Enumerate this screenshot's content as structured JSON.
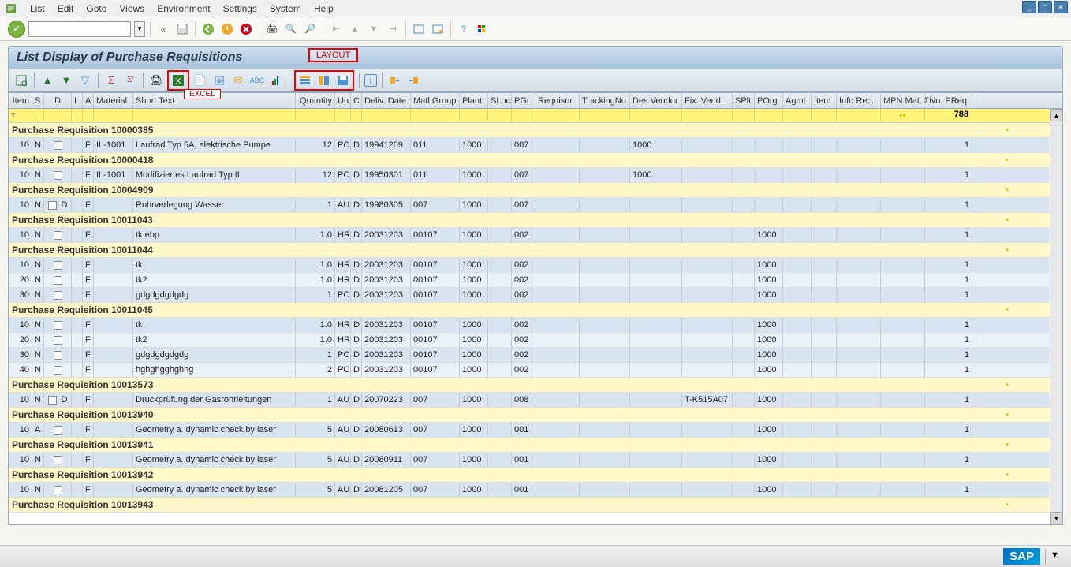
{
  "menu": {
    "items": [
      "List",
      "Edit",
      "Goto",
      "Views",
      "Environment",
      "Settings",
      "System",
      "Help"
    ]
  },
  "title": "List Display of Purchase Requisitions",
  "annotations": {
    "layout": "LAYOUT",
    "excel": "EXCEL"
  },
  "columns": [
    "Item",
    "S",
    "D",
    "I",
    "A",
    "Material",
    "Short Text",
    "Quantity",
    "Un",
    "C",
    "Deliv. Date",
    "Matl Group",
    "Plant",
    "SLoc",
    "PGr",
    "Requisnr.",
    "TrackingNo",
    "Des.Vendor",
    "Fix. Vend.",
    "SPlt",
    "POrg",
    "Agmt",
    "Item",
    "Info Rec.",
    "MPN Mat.",
    "ΣNo. PReq."
  ],
  "total": "788",
  "groups": [
    {
      "label": "Purchase Requisition 10000385",
      "count": "1",
      "rows": [
        {
          "item": "10",
          "s": "N",
          "d": "",
          "i": "",
          "a": "F",
          "mat": "IL-1001",
          "txt": "Laufrad Typ 5A, elektrische Pumpe",
          "qty": "12",
          "un": "PC",
          "c": "D",
          "deliv": "19941209",
          "mg": "011",
          "plant": "1000",
          "sloc": "",
          "pgr": "007",
          "req": "",
          "trk": "",
          "desv": "1000",
          "fix": "",
          "splt": "",
          "porg": "",
          "agmt": "",
          "it2": "",
          "info": "",
          "mpn": "",
          "np": "1"
        }
      ]
    },
    {
      "label": "Purchase Requisition 10000418",
      "count": "1",
      "rows": [
        {
          "item": "10",
          "s": "N",
          "d": "",
          "i": "",
          "a": "F",
          "mat": "IL-1001",
          "txt": "Modifiziertes Laufrad Typ II",
          "qty": "12",
          "un": "PC",
          "c": "D",
          "deliv": "19950301",
          "mg": "011",
          "plant": "1000",
          "sloc": "",
          "pgr": "007",
          "req": "",
          "trk": "",
          "desv": "1000",
          "fix": "",
          "splt": "",
          "porg": "",
          "agmt": "",
          "it2": "",
          "info": "",
          "mpn": "",
          "np": "1"
        }
      ]
    },
    {
      "label": "Purchase Requisition 10004909",
      "count": "1",
      "rows": [
        {
          "item": "10",
          "s": "N",
          "d": "D",
          "i": "",
          "a": "F",
          "mat": "",
          "txt": "Rohrverlegung Wasser",
          "qty": "1",
          "un": "AU",
          "c": "D",
          "deliv": "19980305",
          "mg": "007",
          "plant": "1000",
          "sloc": "",
          "pgr": "007",
          "req": "",
          "trk": "",
          "desv": "",
          "fix": "",
          "splt": "",
          "porg": "",
          "agmt": "",
          "it2": "",
          "info": "",
          "mpn": "",
          "np": "1"
        }
      ]
    },
    {
      "label": "Purchase Requisition 10011043",
      "count": "1",
      "rows": [
        {
          "item": "10",
          "s": "N",
          "d": "",
          "i": "",
          "a": "F",
          "mat": "",
          "txt": "tk ebp",
          "qty": "1.0",
          "un": "HR",
          "c": "D",
          "deliv": "20031203",
          "mg": "00107",
          "plant": "1000",
          "sloc": "",
          "pgr": "002",
          "req": "",
          "trk": "",
          "desv": "",
          "fix": "",
          "splt": "",
          "porg": "1000",
          "agmt": "",
          "it2": "",
          "info": "",
          "mpn": "",
          "np": "1"
        }
      ]
    },
    {
      "label": "Purchase Requisition 10011044",
      "count": "3",
      "rows": [
        {
          "item": "10",
          "s": "N",
          "d": "",
          "i": "",
          "a": "F",
          "mat": "",
          "txt": "tk",
          "qty": "1.0",
          "un": "HR",
          "c": "D",
          "deliv": "20031203",
          "mg": "00107",
          "plant": "1000",
          "sloc": "",
          "pgr": "002",
          "req": "",
          "trk": "",
          "desv": "",
          "fix": "",
          "splt": "",
          "porg": "1000",
          "agmt": "",
          "it2": "",
          "info": "",
          "mpn": "",
          "np": "1"
        },
        {
          "item": "20",
          "s": "N",
          "d": "",
          "i": "",
          "a": "F",
          "mat": "",
          "txt": "tk2",
          "qty": "1.0",
          "un": "HR",
          "c": "D",
          "deliv": "20031203",
          "mg": "00107",
          "plant": "1000",
          "sloc": "",
          "pgr": "002",
          "req": "",
          "trk": "",
          "desv": "",
          "fix": "",
          "splt": "",
          "porg": "1000",
          "agmt": "",
          "it2": "",
          "info": "",
          "mpn": "",
          "np": "1"
        },
        {
          "item": "30",
          "s": "N",
          "d": "",
          "i": "",
          "a": "F",
          "mat": "",
          "txt": "gdgdgdgdgdg",
          "qty": "1",
          "un": "PC",
          "c": "D",
          "deliv": "20031203",
          "mg": "00107",
          "plant": "1000",
          "sloc": "",
          "pgr": "002",
          "req": "",
          "trk": "",
          "desv": "",
          "fix": "",
          "splt": "",
          "porg": "1000",
          "agmt": "",
          "it2": "",
          "info": "",
          "mpn": "",
          "np": "1"
        }
      ]
    },
    {
      "label": "Purchase Requisition 10011045",
      "count": "4",
      "rows": [
        {
          "item": "10",
          "s": "N",
          "d": "",
          "i": "",
          "a": "F",
          "mat": "",
          "txt": "tk",
          "qty": "1.0",
          "un": "HR",
          "c": "D",
          "deliv": "20031203",
          "mg": "00107",
          "plant": "1000",
          "sloc": "",
          "pgr": "002",
          "req": "",
          "trk": "",
          "desv": "",
          "fix": "",
          "splt": "",
          "porg": "1000",
          "agmt": "",
          "it2": "",
          "info": "",
          "mpn": "",
          "np": "1"
        },
        {
          "item": "20",
          "s": "N",
          "d": "",
          "i": "",
          "a": "F",
          "mat": "",
          "txt": "tk2",
          "qty": "1.0",
          "un": "HR",
          "c": "D",
          "deliv": "20031203",
          "mg": "00107",
          "plant": "1000",
          "sloc": "",
          "pgr": "002",
          "req": "",
          "trk": "",
          "desv": "",
          "fix": "",
          "splt": "",
          "porg": "1000",
          "agmt": "",
          "it2": "",
          "info": "",
          "mpn": "",
          "np": "1"
        },
        {
          "item": "30",
          "s": "N",
          "d": "",
          "i": "",
          "a": "F",
          "mat": "",
          "txt": "gdgdgdgdgdg",
          "qty": "1",
          "un": "PC",
          "c": "D",
          "deliv": "20031203",
          "mg": "00107",
          "plant": "1000",
          "sloc": "",
          "pgr": "002",
          "req": "",
          "trk": "",
          "desv": "",
          "fix": "",
          "splt": "",
          "porg": "1000",
          "agmt": "",
          "it2": "",
          "info": "",
          "mpn": "",
          "np": "1"
        },
        {
          "item": "40",
          "s": "N",
          "d": "",
          "i": "",
          "a": "F",
          "mat": "",
          "txt": "hghghgghghhg",
          "qty": "2",
          "un": "PC",
          "c": "D",
          "deliv": "20031203",
          "mg": "00107",
          "plant": "1000",
          "sloc": "",
          "pgr": "002",
          "req": "",
          "trk": "",
          "desv": "",
          "fix": "",
          "splt": "",
          "porg": "1000",
          "agmt": "",
          "it2": "",
          "info": "",
          "mpn": "",
          "np": "1"
        }
      ]
    },
    {
      "label": "Purchase Requisition 10013573",
      "count": "1",
      "rows": [
        {
          "item": "10",
          "s": "N",
          "d": "D",
          "i": "",
          "a": "F",
          "mat": "",
          "txt": "Druckprüfung der Gasrohrleitungen",
          "qty": "1",
          "un": "AU",
          "c": "D",
          "deliv": "20070223",
          "mg": "007",
          "plant": "1000",
          "sloc": "",
          "pgr": "008",
          "req": "",
          "trk": "",
          "desv": "",
          "fix": "T-K515A07",
          "splt": "",
          "porg": "1000",
          "agmt": "",
          "it2": "",
          "info": "",
          "mpn": "",
          "np": "1"
        }
      ]
    },
    {
      "label": "Purchase Requisition 10013940",
      "count": "1",
      "rows": [
        {
          "item": "10",
          "s": "A",
          "d": "",
          "i": "",
          "a": "F",
          "mat": "",
          "txt": "Geometry a. dynamic check by laser",
          "qty": "5",
          "un": "AU",
          "c": "D",
          "deliv": "20080613",
          "mg": "007",
          "plant": "1000",
          "sloc": "",
          "pgr": "001",
          "req": "",
          "trk": "",
          "desv": "",
          "fix": "",
          "splt": "",
          "porg": "1000",
          "agmt": "",
          "it2": "",
          "info": "",
          "mpn": "",
          "np": "1"
        }
      ]
    },
    {
      "label": "Purchase Requisition 10013941",
      "count": "1",
      "rows": [
        {
          "item": "10",
          "s": "N",
          "d": "",
          "i": "",
          "a": "F",
          "mat": "",
          "txt": "Geometry a. dynamic check by laser",
          "qty": "5",
          "un": "AU",
          "c": "D",
          "deliv": "20080911",
          "mg": "007",
          "plant": "1000",
          "sloc": "",
          "pgr": "001",
          "req": "",
          "trk": "",
          "desv": "",
          "fix": "",
          "splt": "",
          "porg": "1000",
          "agmt": "",
          "it2": "",
          "info": "",
          "mpn": "",
          "np": "1"
        }
      ]
    },
    {
      "label": "Purchase Requisition 10013942",
      "count": "1",
      "rows": [
        {
          "item": "10",
          "s": "N",
          "d": "",
          "i": "",
          "a": "F",
          "mat": "",
          "txt": "Geometry a. dynamic check by laser",
          "qty": "5",
          "un": "AU",
          "c": "D",
          "deliv": "20081205",
          "mg": "007",
          "plant": "1000",
          "sloc": "",
          "pgr": "001",
          "req": "",
          "trk": "",
          "desv": "",
          "fix": "",
          "splt": "",
          "porg": "1000",
          "agmt": "",
          "it2": "",
          "info": "",
          "mpn": "",
          "np": "1"
        }
      ]
    },
    {
      "label": "Purchase Requisition 10013943",
      "count": "1",
      "rows": []
    }
  ]
}
